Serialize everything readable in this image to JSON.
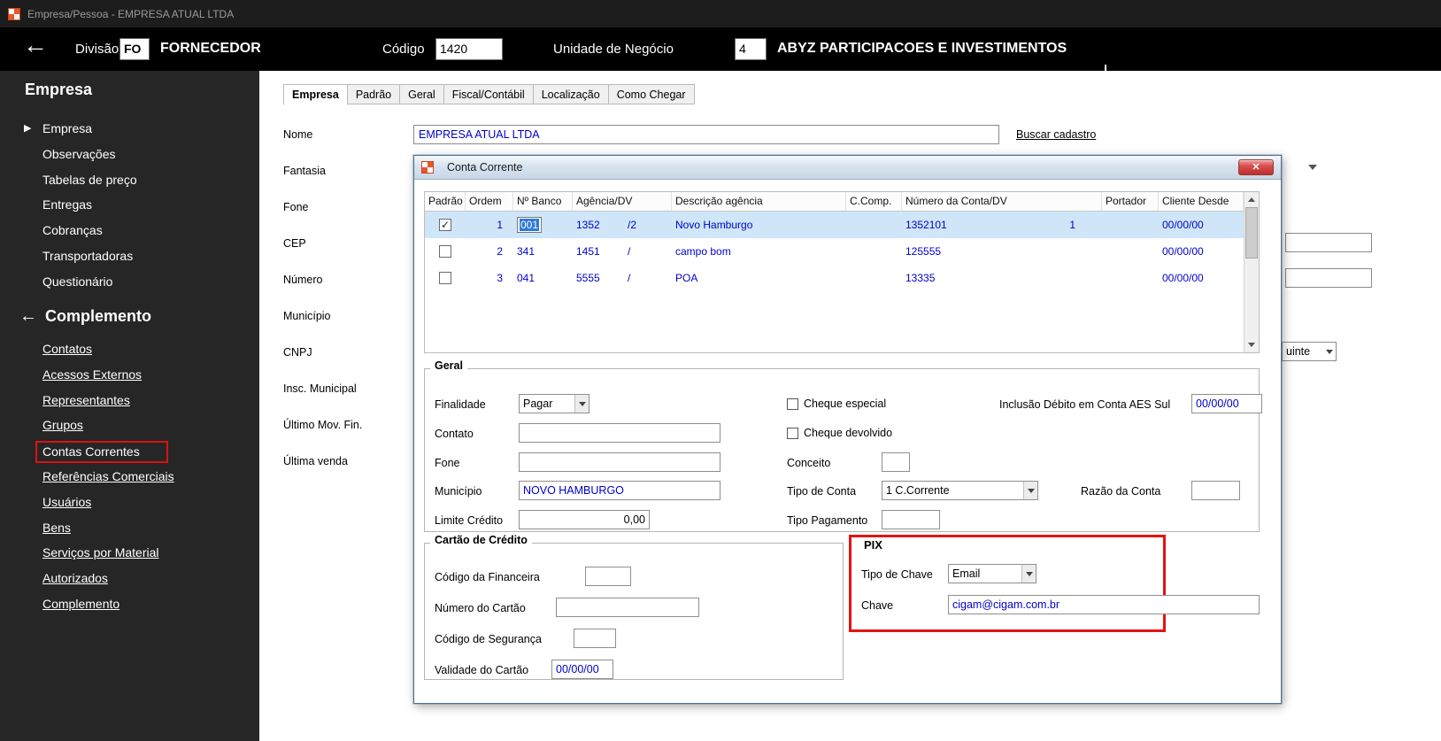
{
  "icons": {
    "check": "✓"
  },
  "titlebar": {
    "title": "Empresa/Pessoa - EMPRESA ATUAL LTDA"
  },
  "header": {
    "back_icon": "←",
    "divisao_label": "Divisão",
    "divisao_code": "FO",
    "divisao_name": "FORNECEDOR",
    "codigo_label": "Código",
    "codigo_value": "1420",
    "unidade_label": "Unidade de Negócio",
    "unidade_code": "4",
    "unidade_name": "ABYZ PARTICIPACOES E INVESTIMENTOS"
  },
  "sidebar": {
    "empresa_title": "Empresa",
    "arrow_icon": "▶",
    "back_icon": "←",
    "empresa_items": [
      "Empresa",
      "Observações",
      "Tabelas de preço",
      "Entregas",
      "Cobranças",
      "Transportadoras",
      "Questionário"
    ],
    "complemento_title": "Complemento",
    "complemento_items": [
      "Contatos",
      "Acessos Externos",
      "Representantes",
      "Grupos",
      "Contas Correntes",
      "Referências Comerciais",
      "Usuários",
      "Bens",
      "Serviços por Material",
      "Autorizados",
      "Complemento"
    ]
  },
  "main": {
    "tabs": [
      "Empresa",
      "Padrão",
      "Geral",
      "Fiscal/Contábil",
      "Localização",
      "Como Chegar"
    ],
    "field_labels": [
      "Nome",
      "Fantasia",
      "Fone",
      "CEP",
      "Número",
      "Município",
      "CNPJ",
      "Insc. Municipal",
      "Último Mov. Fin.",
      "Última venda"
    ],
    "nome_value": "EMPRESA ATUAL LTDA",
    "buscar_link": "Buscar cadastro",
    "partial_combo_value": "uinte"
  },
  "dialog": {
    "title": "Conta Corrente",
    "close_icon": "✕",
    "table": {
      "columns": [
        "Padrão",
        "Ordem",
        "Nº Banco",
        "Agência/DV",
        "Descrição agência",
        "C.Comp.",
        "Número da Conta/DV",
        "Portador",
        "Cliente Desde"
      ],
      "rows": [
        {
          "padrao": true,
          "ordem": "1",
          "banco": "001",
          "agencia": "1352",
          "agencia_dv": "/2",
          "descricao": "Novo Hamburgo",
          "ccomp": "",
          "conta": "1352101",
          "conta_dv": "1",
          "portador": "",
          "cliente_desde": "00/00/00",
          "selected": true
        },
        {
          "padrao": false,
          "ordem": "2",
          "banco": "341",
          "agencia": "1451",
          "agencia_dv": "/",
          "descricao": "campo bom",
          "ccomp": "",
          "conta": "125555",
          "conta_dv": "",
          "portador": "",
          "cliente_desde": "00/00/00",
          "selected": false
        },
        {
          "padrao": false,
          "ordem": "3",
          "banco": "041",
          "agencia": "5555",
          "agencia_dv": "/",
          "descricao": "POA",
          "ccomp": "",
          "conta": "13335",
          "conta_dv": "",
          "portador": "",
          "cliente_desde": "00/00/00",
          "selected": false
        }
      ]
    },
    "geral": {
      "title": "Geral",
      "finalidade_label": "Finalidade",
      "finalidade_value": "Pagar",
      "contato_label": "Contato",
      "contato_value": "",
      "fone_label": "Fone",
      "fone_value": "",
      "municipio_label": "Município",
      "municipio_value": "NOVO HAMBURGO",
      "limite_label": "Limite Crédito",
      "limite_value": "0,00",
      "cheque_especial_label": "Cheque especial",
      "cheque_devolvido_label": "Cheque devolvido",
      "conceito_label": "Conceito",
      "conceito_value": "",
      "tipo_conta_label": "Tipo de Conta",
      "tipo_conta_value": "1 C.Corrente",
      "tipo_pagamento_label": "Tipo Pagamento",
      "tipo_pagamento_value": "",
      "inclusao_label": "Inclusão Débito em Conta AES Sul",
      "inclusao_value": "00/00/00",
      "razao_label": "Razão da Conta",
      "razao_value": ""
    },
    "cartao": {
      "title": "Cartão de Crédito",
      "financeira_label": "Código da Financeira",
      "financeira_value": "",
      "numero_label": "Número do Cartão",
      "numero_value": "",
      "seguranca_label": "Código de Segurança",
      "seguranca_value": "",
      "validade_label": "Validade do Cartão",
      "validade_value": "00/00/00"
    },
    "pix": {
      "title": "PIX",
      "tipo_label": "Tipo de Chave",
      "tipo_value": "Email",
      "chave_label": "Chave",
      "chave_value": "cigam@cigam.com.br"
    }
  }
}
